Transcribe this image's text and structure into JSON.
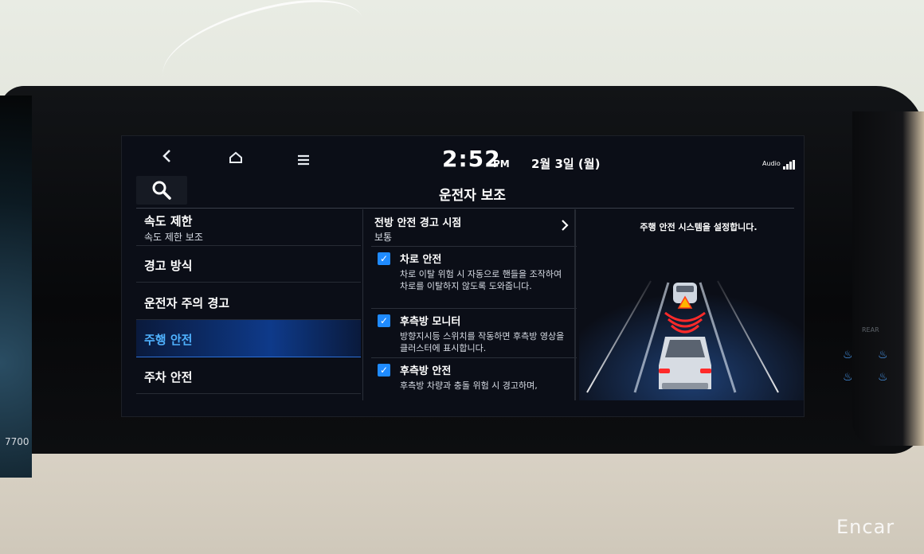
{
  "status_bar": {
    "back_icon": "back-chevron-icon",
    "home_icon": "home-icon",
    "menu_icon": "hamburger-menu-icon",
    "time": "2:52",
    "ampm": "PM",
    "date": "2월 3일 (월)",
    "audio_label": "Audio"
  },
  "search": {
    "icon": "search-icon"
  },
  "page_title": "운전자 보조",
  "menu": {
    "items": [
      {
        "label": "속도 제한",
        "sub": "속도 제한 보조"
      },
      {
        "label": "경고 방식"
      },
      {
        "label": "운전자 주의 경고"
      },
      {
        "label": "주행 안전",
        "active": true
      },
      {
        "label": "주차 안전"
      }
    ]
  },
  "forward": {
    "title": "전방 안전 경고 시점",
    "value": "보통"
  },
  "options": [
    {
      "title": "차로 안전",
      "checked": true,
      "desc": "차로 이탈 위험 시 자동으로 핸들을 조작하여 차로를 이탈하지 않도록 도와줍니다."
    },
    {
      "title": "후측방 모니터",
      "checked": true,
      "desc": "방향지시등 스위치를 작동하면 후측방 영상을 클러스터에 표시합니다."
    },
    {
      "title": "후측방 안전",
      "checked": true,
      "desc": "후측방 차량과 충돌 위험 시 경고하며,"
    }
  ],
  "illustration": {
    "caption": "주행 안전 시스템을 설정합니다."
  },
  "cluster": {
    "rpm_label": "7700"
  },
  "rear_label": "REAR",
  "watermark": "Encar",
  "colors": {
    "accent": "#1f8bff",
    "active_text": "#4fb2ff",
    "warning": "#ff2a2a"
  }
}
